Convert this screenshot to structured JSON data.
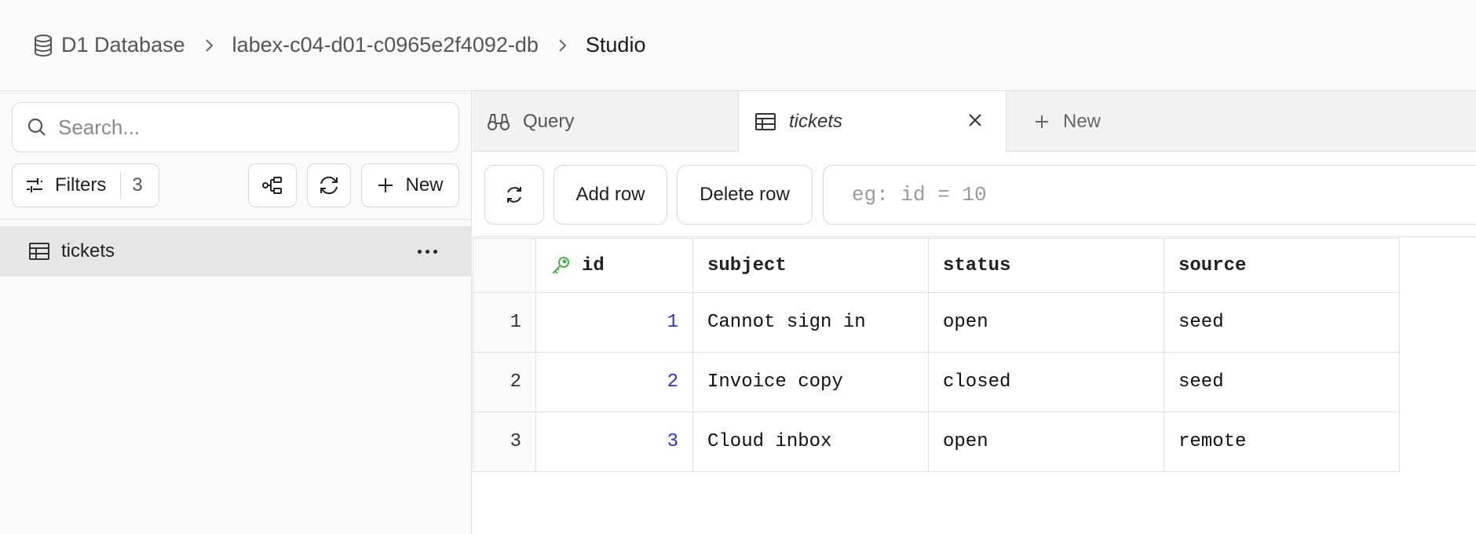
{
  "breadcrumb": {
    "items": [
      "D1 Database",
      "labex-c04-d01-c0965e2f4092-db"
    ],
    "current": "Studio"
  },
  "sidebar": {
    "search_placeholder": "Search...",
    "filters_label": "Filters",
    "filters_count": "3",
    "new_label": "New",
    "tables": [
      {
        "name": "tickets"
      }
    ]
  },
  "tabs": [
    {
      "label": "Query",
      "icon": "binoculars-icon"
    },
    {
      "label": "tickets",
      "icon": "table-icon",
      "active": true
    },
    {
      "label": "New",
      "icon": "plus-icon"
    }
  ],
  "actions": {
    "add_row": "Add row",
    "delete_row": "Delete row",
    "where_placeholder": "eg: id = 10"
  },
  "grid": {
    "columns": [
      "id",
      "subject",
      "status",
      "source"
    ],
    "primary_key_column": "id",
    "rows": [
      {
        "num": "1",
        "cells": [
          "1",
          "Cannot sign in",
          "open",
          "seed"
        ]
      },
      {
        "num": "2",
        "cells": [
          "2",
          "Invoice copy",
          "closed",
          "seed"
        ]
      },
      {
        "num": "3",
        "cells": [
          "3",
          "Cloud inbox",
          "open",
          "remote"
        ]
      }
    ]
  },
  "colors": {
    "id_value": "#3333cc",
    "key_icon": "#4caf50",
    "selected_table_bg": "#e6e6e6"
  }
}
